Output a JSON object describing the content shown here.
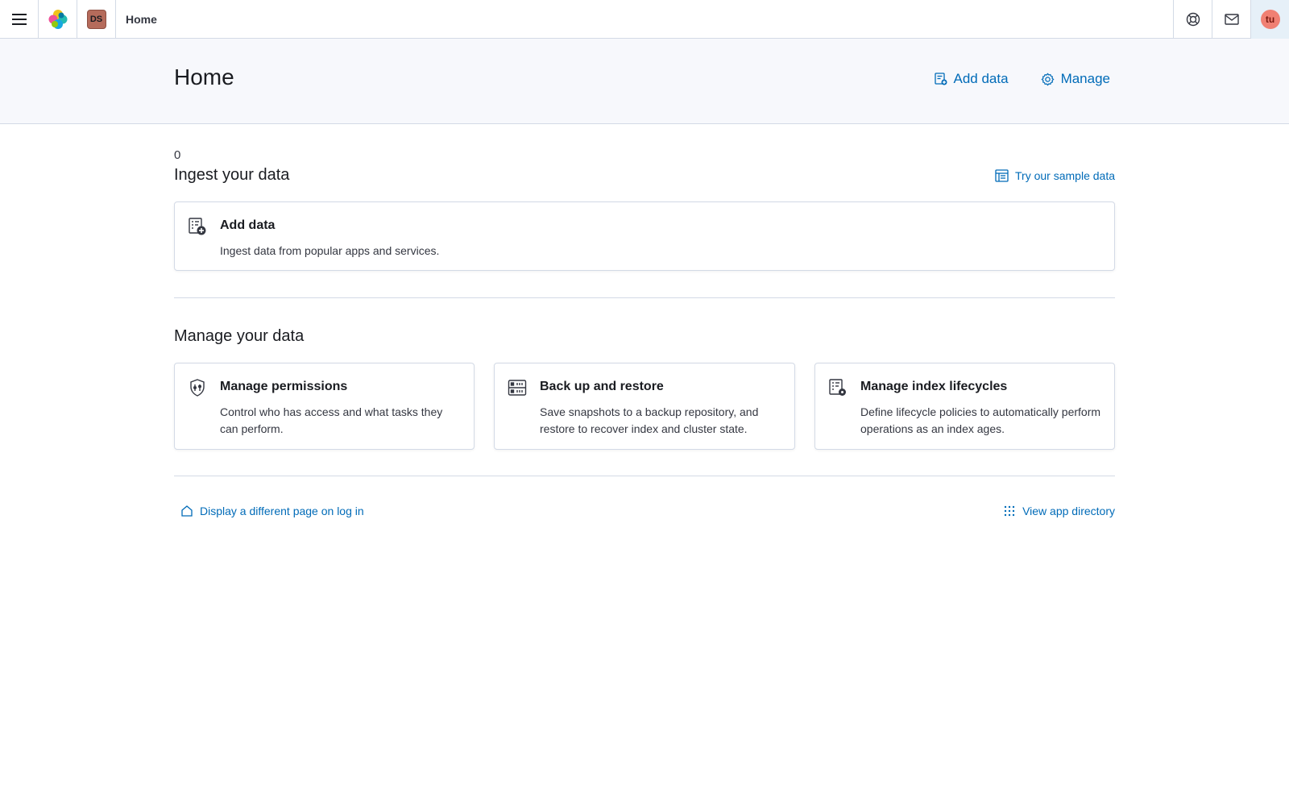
{
  "topbar": {
    "menu_icon": "hamburger-menu-icon",
    "logo_icon": "elastic-logo-icon",
    "space_badge": "DS",
    "breadcrumb": "Home",
    "help_icon": "help-lifebuoy-icon",
    "news_icon": "newsfeed-mail-icon",
    "user_initials": "tu"
  },
  "header": {
    "title": "Home",
    "add_data_label": "Add data",
    "manage_label": "Manage"
  },
  "ingest": {
    "counter": "0",
    "title": "Ingest your data",
    "sample_link": "Try our sample data",
    "card": {
      "title": "Add data",
      "description": "Ingest data from popular apps and services."
    }
  },
  "manage": {
    "title": "Manage your data",
    "cards": [
      {
        "title": "Manage permissions",
        "description": "Control who has access and what tasks they can perform.",
        "icon": "shield-permissions-icon"
      },
      {
        "title": "Back up and restore",
        "description": "Save snapshots to a backup repository, and restore to recover index and cluster state.",
        "icon": "storage-backup-icon"
      },
      {
        "title": "Manage index lifecycles",
        "description": "Define lifecycle policies to automatically perform operations as an index ages.",
        "icon": "index-lifecycle-icon"
      }
    ]
  },
  "footer": {
    "display_page_link": "Display a different page on log in",
    "app_directory_link": "View app directory"
  },
  "colors": {
    "link": "#006bb8",
    "border": "#d3dae6",
    "header_bg": "#f7f8fc",
    "avatar_bg": "#f08073",
    "space_badge_bg": "#b56b5b"
  }
}
